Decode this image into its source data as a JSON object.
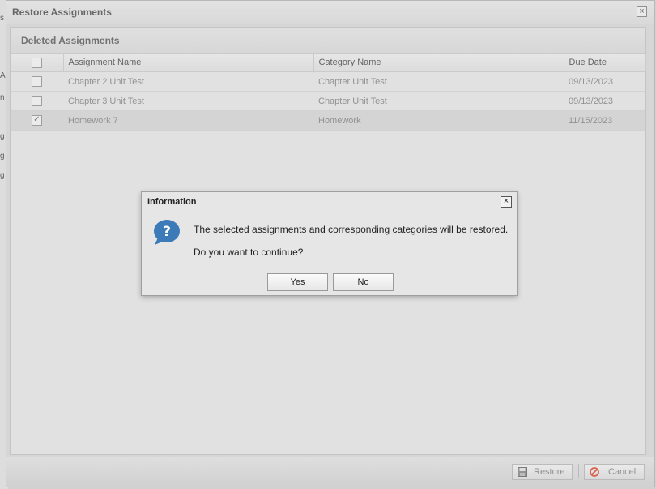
{
  "background": {
    "fragments": [
      "s",
      "A",
      "n",
      "g",
      "g",
      "g"
    ]
  },
  "window": {
    "title": "Restore Assignments",
    "close_glyph": "×"
  },
  "panel": {
    "title": "Deleted Assignments",
    "columns": {
      "name": "Assignment Name",
      "category": "Category Name",
      "due": "Due Date"
    },
    "rows": [
      {
        "name": "Chapter 2 Unit Test",
        "category": "Chapter Unit Test",
        "due": "09/13/2023",
        "checked": false
      },
      {
        "name": "Chapter 3 Unit Test",
        "category": "Chapter Unit Test",
        "due": "09/13/2023",
        "checked": false
      },
      {
        "name": "Homework 7",
        "category": "Homework",
        "due": "11/15/2023",
        "checked": true
      }
    ]
  },
  "footer": {
    "restore_label": "Restore",
    "cancel_label": "Cancel"
  },
  "dialog": {
    "title": "Information",
    "message": "The selected assignments and corresponding categories will be restored.",
    "question": "Do you want to continue?",
    "yes_label": "Yes",
    "no_label": "No",
    "icon": "question-icon",
    "close_glyph": "×"
  },
  "colors": {
    "icon_blue": "#3d7ab8",
    "cancel_red": "#e0533c"
  }
}
